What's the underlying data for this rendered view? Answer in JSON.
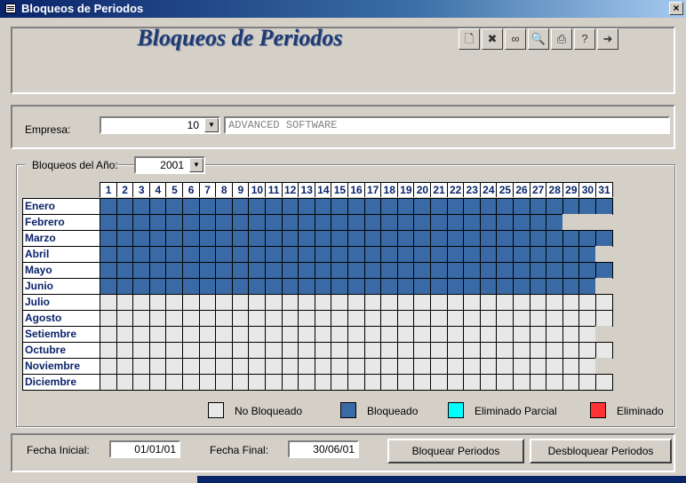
{
  "window": {
    "title": "Bloqueos de Periodos",
    "close_label": "×"
  },
  "header": {
    "title": "Bloqueos de Periodos"
  },
  "toolbar": {
    "buttons": [
      {
        "icon": "new-document-icon",
        "glyph": "🗋"
      },
      {
        "icon": "delete-record-icon",
        "glyph": "✖"
      },
      {
        "icon": "binoculars-icon",
        "glyph": "∞"
      },
      {
        "icon": "print-preview-icon",
        "glyph": "🔍"
      },
      {
        "icon": "print-icon",
        "glyph": "⎙"
      },
      {
        "icon": "help-icon",
        "glyph": "?"
      },
      {
        "icon": "exit-door-icon",
        "glyph": "➜"
      }
    ]
  },
  "empresa": {
    "label": "Empresa:",
    "code": "10",
    "name": "ADVANCED SOFTWARE"
  },
  "bloqueos": {
    "label": "Bloqueos del Año:",
    "year": "2001"
  },
  "calendar": {
    "days": [
      "1",
      "2",
      "3",
      "4",
      "5",
      "6",
      "7",
      "8",
      "9",
      "10",
      "11",
      "12",
      "13",
      "14",
      "15",
      "16",
      "17",
      "18",
      "19",
      "20",
      "21",
      "22",
      "23",
      "24",
      "25",
      "26",
      "27",
      "28",
      "29",
      "30",
      "31"
    ],
    "months": [
      {
        "name": "Enero",
        "days_in_month": 31,
        "blocked": true
      },
      {
        "name": "Febrero",
        "days_in_month": 28,
        "blocked": true
      },
      {
        "name": "Marzo",
        "days_in_month": 31,
        "blocked": true
      },
      {
        "name": "Abril",
        "days_in_month": 30,
        "blocked": true
      },
      {
        "name": "Mayo",
        "days_in_month": 31,
        "blocked": true
      },
      {
        "name": "Junio",
        "days_in_month": 30,
        "blocked": true
      },
      {
        "name": "Julio",
        "days_in_month": 31,
        "blocked": false
      },
      {
        "name": "Agosto",
        "days_in_month": 31,
        "blocked": false
      },
      {
        "name": "Setiembre",
        "days_in_month": 30,
        "blocked": false
      },
      {
        "name": "Octubre",
        "days_in_month": 31,
        "blocked": false
      },
      {
        "name": "Noviembre",
        "days_in_month": 30,
        "blocked": false
      },
      {
        "name": "Diciembre",
        "days_in_month": 31,
        "blocked": false
      }
    ],
    "colors": {
      "no_bloqueado": "#e8e8e8",
      "bloqueado": "#3a6aa5",
      "eliminado_parcial": "#00ffff",
      "eliminado": "#ff3333"
    }
  },
  "legend": {
    "no_bloqueado": "No Bloqueado",
    "bloqueado": "Bloqueado",
    "eliminado_parcial": "Eliminado Parcial",
    "eliminado": "Eliminado"
  },
  "footer": {
    "fecha_inicial_label": "Fecha Inicial:",
    "fecha_inicial": "01/01/01",
    "fecha_final_label": "Fecha Final:",
    "fecha_final": "30/06/01",
    "bloquear_button": "Bloquear Periodos",
    "desbloquear_button": "Desbloquear Periodos"
  }
}
